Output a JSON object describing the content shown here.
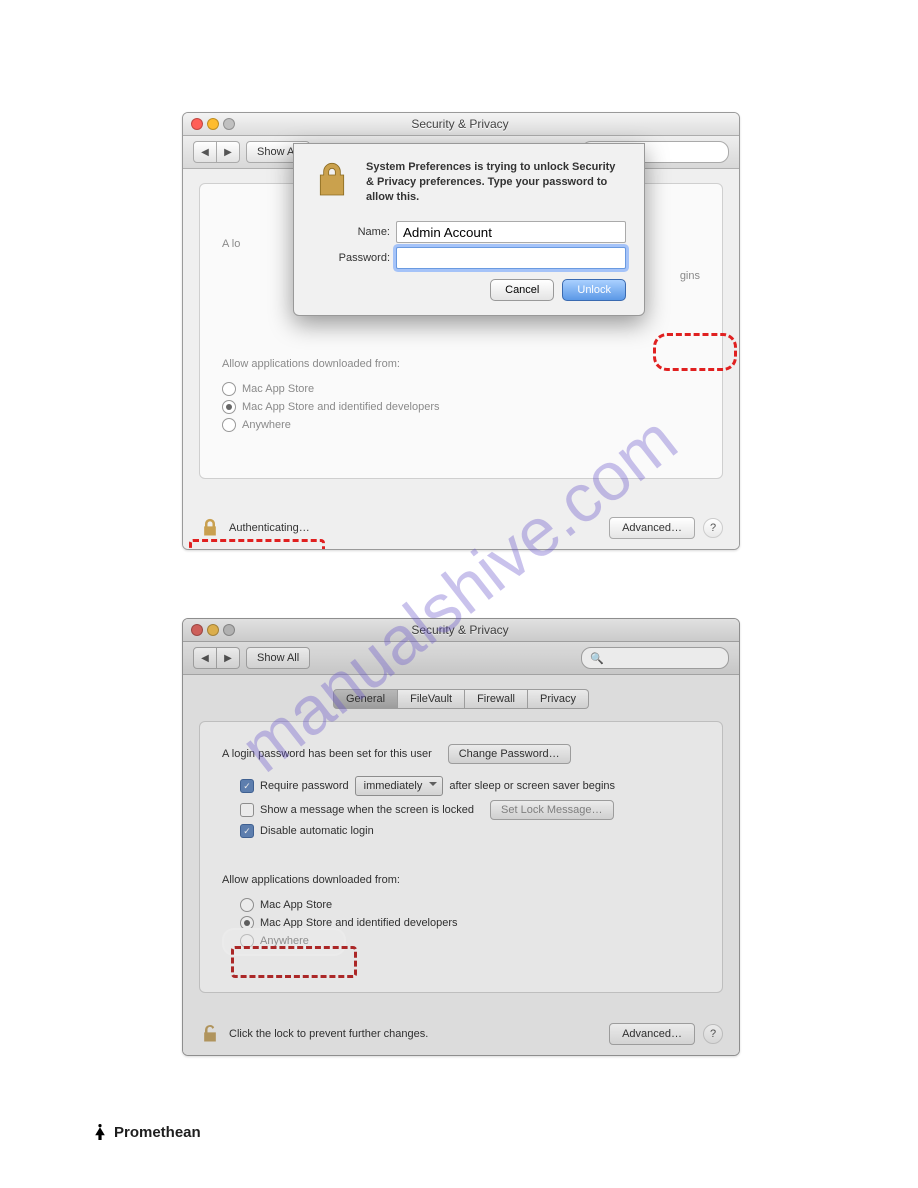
{
  "win1": {
    "title": "Security & Privacy",
    "showAll": "Show All",
    "card": {
      "loginPrefix": "A lo",
      "endsText": "gins",
      "section": "Allow applications downloaded from:",
      "opt1": "Mac App Store",
      "opt2": "Mac App Store and identified developers",
      "opt3": "Anywhere"
    },
    "footer": {
      "status": "Authenticating…",
      "advanced": "Advanced…",
      "help": "?"
    },
    "modal": {
      "msg": "System Preferences is trying to unlock Security & Privacy preferences. Type your password to allow this.",
      "nameLabel": "Name:",
      "nameValue": "Admin Account",
      "passLabel": "Password:",
      "cancel": "Cancel",
      "unlock": "Unlock"
    }
  },
  "win2": {
    "title": "Security & Privacy",
    "showAll": "Show All",
    "tabs": [
      "General",
      "FileVault",
      "Firewall",
      "Privacy"
    ],
    "card": {
      "loginLine": "A login password has been set for this user",
      "changePw": "Change Password…",
      "req": "Require password",
      "imm": "immediately",
      "reqAfter": "after sleep or screen saver begins",
      "showMsg": "Show a message when the screen is locked",
      "setLock": "Set Lock Message…",
      "disableAuto": "Disable automatic login",
      "section": "Allow applications downloaded from:",
      "opt1": "Mac App Store",
      "opt2": "Mac App Store and identified developers",
      "opt3": "Anywhere"
    },
    "footer": {
      "status": "Click the lock to prevent further changes.",
      "advanced": "Advanced…",
      "help": "?"
    }
  },
  "brand": "Promethean"
}
